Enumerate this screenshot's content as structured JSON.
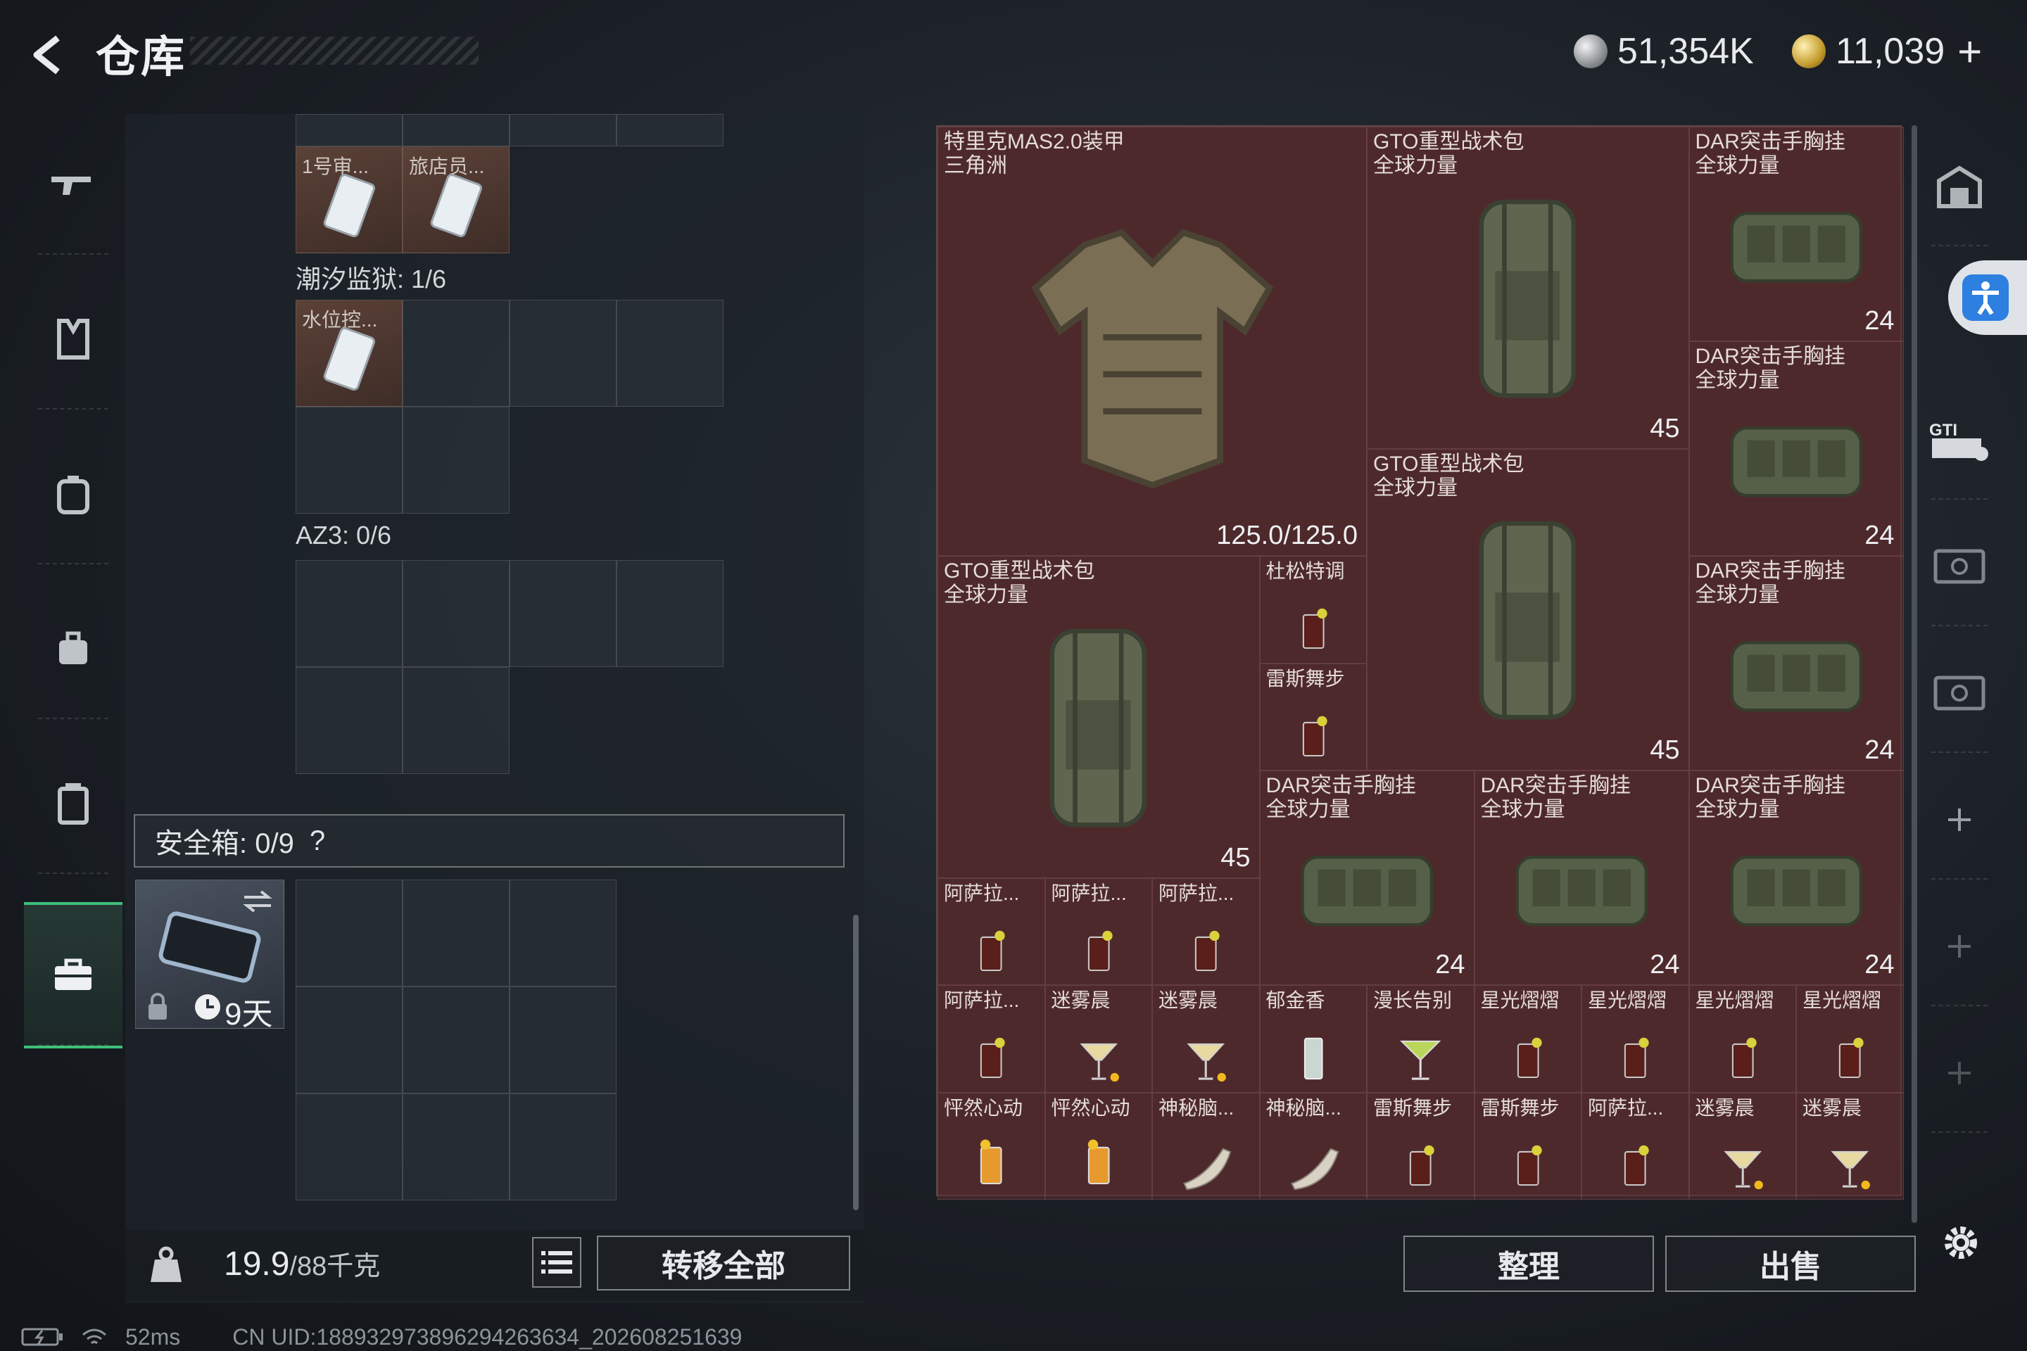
{
  "header": {
    "title": "仓库",
    "currency_silver": "51,354K",
    "currency_gold": "11,039",
    "plus": "+"
  },
  "left_nav": {
    "items": [
      {
        "id": "weapon",
        "icon": "rifle-icon"
      },
      {
        "id": "chest-rig",
        "icon": "vest-icon"
      },
      {
        "id": "backpack",
        "icon": "backpack-icon"
      },
      {
        "id": "bag",
        "icon": "bag-icon"
      },
      {
        "id": "container",
        "icon": "canister-icon"
      },
      {
        "id": "safebox",
        "icon": "briefcase-icon",
        "active": true
      }
    ]
  },
  "left_panel": {
    "keys": [
      {
        "label": "1号审..."
      },
      {
        "label": "旅店员..."
      }
    ],
    "tide_prison_label": "潮汐监狱: 1/6",
    "tide_prison_items": [
      {
        "label": "水位控..."
      }
    ],
    "az3_label": "AZ3: 0/6",
    "safebox_label": "安全箱: 0/9",
    "safebox_help": "?",
    "safebox_item_days": "9天",
    "weight": "19.9",
    "weight_max": "/88千克",
    "transfer_all": "转移全部"
  },
  "stash": {
    "items": [
      {
        "name": "特里克MAS2.0装甲\n三角洲",
        "badge": "125.0/125.0"
      },
      {
        "name": "GTO重型战术包\n全球力量",
        "badge": "45"
      },
      {
        "name": "DAR突击手胸挂\n全球力量",
        "badge": "24"
      },
      {
        "name": "DAR突击手胸挂\n全球力量",
        "badge": "24"
      },
      {
        "name": "GTO重型战术包\n全球力量",
        "badge": "45"
      },
      {
        "name": "DAR突击手胸挂\n全球力量",
        "badge": "24"
      },
      {
        "name": "GTO重型战术包\n全球力量",
        "badge": "45"
      },
      {
        "name": "杜松特调",
        "badge": ""
      },
      {
        "name": "雷斯舞步",
        "badge": ""
      },
      {
        "name": "DAR突击手胸挂\n全球力量",
        "badge": "24"
      },
      {
        "name": "DAR突击手胸挂\n全球力量",
        "badge": "24"
      },
      {
        "name": "DAR突击手胸挂\n全球力量",
        "badge": "24"
      },
      {
        "name": "阿萨拉...",
        "badge": ""
      },
      {
        "name": "阿萨拉...",
        "badge": ""
      },
      {
        "name": "阿萨拉...",
        "badge": ""
      },
      {
        "name": "阿萨拉...",
        "badge": ""
      },
      {
        "name": "迷雾晨",
        "badge": ""
      },
      {
        "name": "迷雾晨",
        "badge": ""
      },
      {
        "name": "郁金香",
        "badge": ""
      },
      {
        "name": "漫长告别",
        "badge": ""
      },
      {
        "name": "星光熠熠",
        "badge": ""
      },
      {
        "name": "星光熠熠",
        "badge": ""
      },
      {
        "name": "星光熠熠",
        "badge": ""
      },
      {
        "name": "星光熠熠",
        "badge": ""
      },
      {
        "name": "怦然心动",
        "badge": ""
      },
      {
        "name": "怦然心动",
        "badge": ""
      },
      {
        "name": "神秘脑...",
        "badge": ""
      },
      {
        "name": "神秘脑...",
        "badge": ""
      },
      {
        "name": "雷斯舞步",
        "badge": ""
      },
      {
        "name": "雷斯舞步",
        "badge": ""
      },
      {
        "name": "阿萨拉...",
        "badge": ""
      },
      {
        "name": "迷雾晨",
        "badge": ""
      },
      {
        "name": "迷雾晨",
        "badge": ""
      }
    ],
    "sort_button": "整理",
    "sell_button": "出售"
  },
  "footer": {
    "ping": "52ms",
    "uid": "CN UID:18893297389629426363​4_202608251639"
  },
  "colors": {
    "accent_green": "#3fbf7a",
    "stash_bg": "#3d2426",
    "accessibility_blue": "#2d7fe0"
  }
}
